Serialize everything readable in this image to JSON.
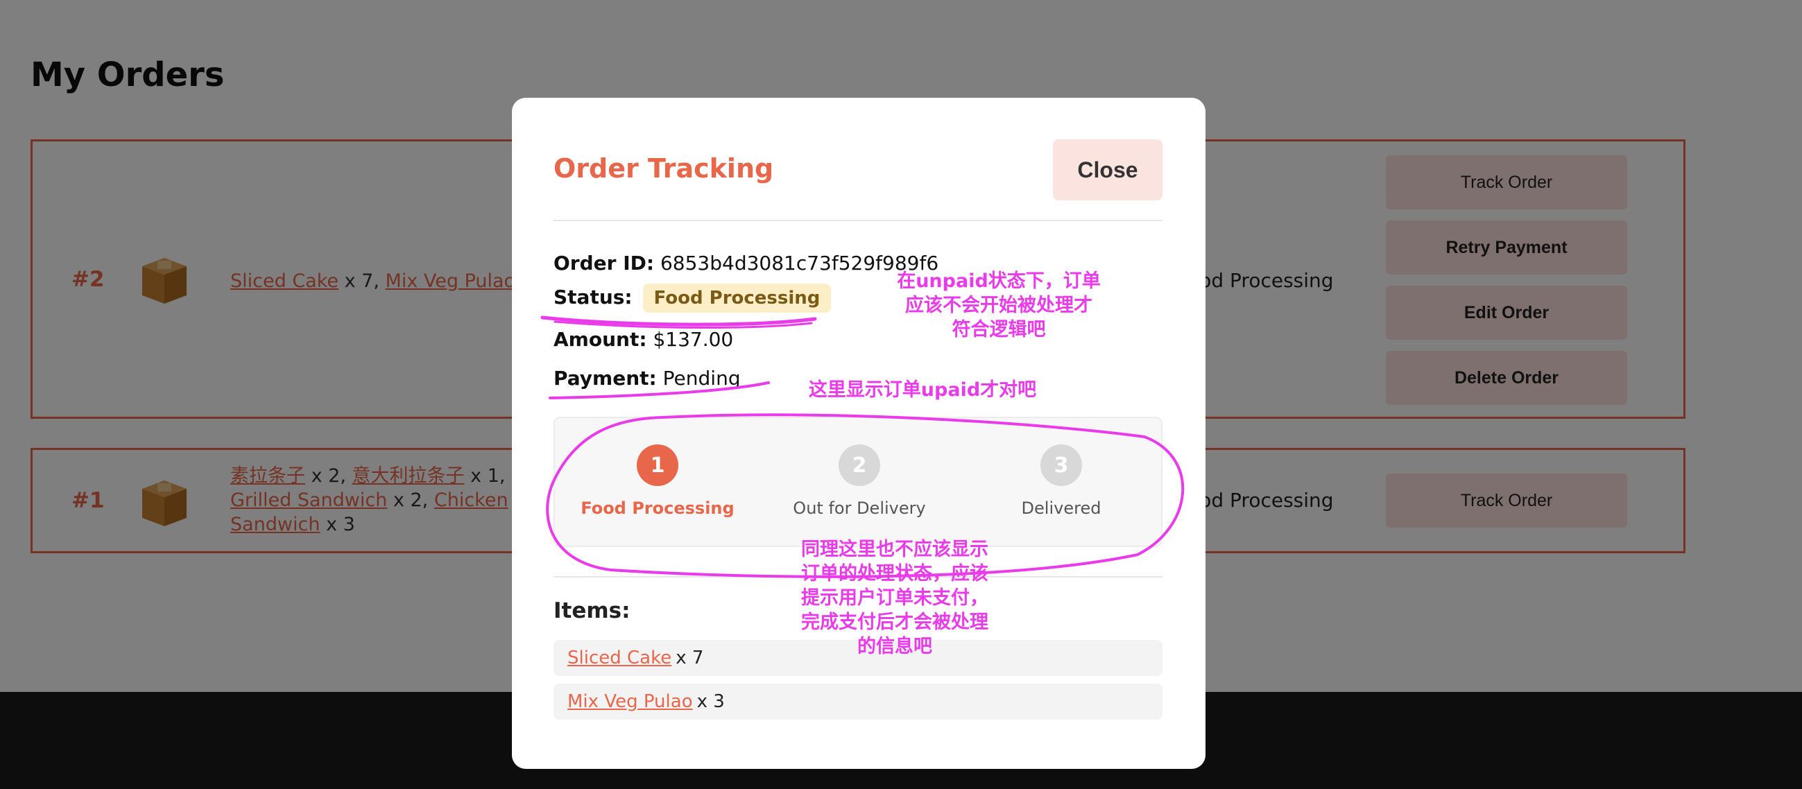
{
  "page": {
    "title": "My Orders"
  },
  "orders": [
    {
      "number": "#2",
      "items": [
        {
          "name": "Sliced Cake",
          "qty": "x 7,"
        },
        {
          "name": "Mix Veg Pulao",
          "qty": "x 3"
        }
      ],
      "status": "Food Processing",
      "buttons": [
        "Track Order",
        "Retry Payment",
        "Edit Order",
        "Delete Order"
      ]
    },
    {
      "number": "#1",
      "items": [
        {
          "name": "素拉条子",
          "qty": "x 2,"
        },
        {
          "name": "意大利拉条子",
          "qty": "x 1,"
        },
        {
          "name": "Grilled Sandwich",
          "qty": "x 2,"
        },
        {
          "name": "Chicken Sandwich",
          "qty": "x 3"
        }
      ],
      "status": "Food Processing",
      "buttons": [
        "Track Order"
      ]
    }
  ],
  "modal": {
    "title": "Order Tracking",
    "close_label": "Close",
    "order_id_label": "Order ID:",
    "order_id": "6853b4d3081c73f529f989f6",
    "status_label": "Status:",
    "status": "Food Processing",
    "amount_label": "Amount:",
    "amount": "$137.00",
    "payment_label": "Payment:",
    "payment": "Pending",
    "steps": [
      {
        "number": "1",
        "label": "Food Processing",
        "active": true
      },
      {
        "number": "2",
        "label": "Out for Delivery",
        "active": false
      },
      {
        "number": "3",
        "label": "Delivered",
        "active": false
      }
    ],
    "items_heading": "Items:",
    "items": [
      {
        "name": "Sliced Cake",
        "qty": "x 7"
      },
      {
        "name": "Mix Veg Pulao",
        "qty": "x 3"
      }
    ]
  },
  "annotations": {
    "note1": [
      "在unpaid状态下，订单",
      "应该不会开始被处理才",
      "符合逻辑吧"
    ],
    "note2": "这里显示订单upaid才对吧",
    "note3": [
      "同理这里也不应该显示",
      "订单的处理状态，应该",
      "提示用户订单未支付，",
      "完成支付后才会被处理",
      "的信息吧"
    ]
  },
  "colors": {
    "accent": "#e8664a",
    "annotation": "#ea3bea",
    "status_badge_bg": "#fcefc8",
    "button_bg": "#fbe0dc"
  }
}
